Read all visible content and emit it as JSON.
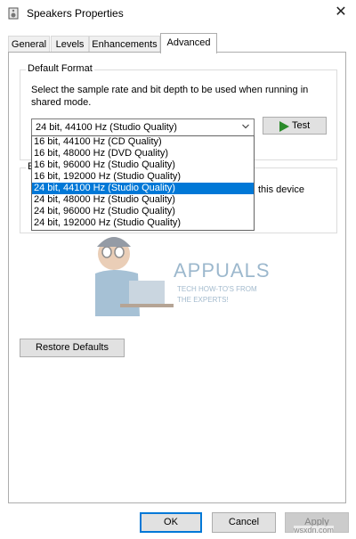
{
  "window": {
    "title": "Speakers Properties",
    "close_glyph": "✕",
    "icon": "speaker-icon"
  },
  "tabs": [
    {
      "label": "General"
    },
    {
      "label": "Levels"
    },
    {
      "label": "Enhancements"
    },
    {
      "label": "Advanced",
      "selected": true
    }
  ],
  "default_format": {
    "group_label": "Default Format",
    "description": "Select the sample rate and bit depth to be used when running in shared mode.",
    "selected_value": "24 bit, 44100 Hz (Studio Quality)",
    "options": [
      "16 bit, 44100 Hz (CD Quality)",
      "16 bit, 48000 Hz (DVD Quality)",
      "16 bit, 96000 Hz (Studio Quality)",
      "16 bit, 192000 Hz (Studio Quality)",
      "24 bit, 44100 Hz (Studio Quality)",
      "24 bit, 48000 Hz (Studio Quality)",
      "24 bit, 96000 Hz (Studio Quality)",
      "24 bit, 192000 Hz (Studio Quality)"
    ],
    "highlighted_index": 4,
    "test_label": "Test"
  },
  "exclusive_mode": {
    "group_label_partial": "E",
    "text_partial": "this device"
  },
  "watermark": {
    "title": "APPUALS",
    "sub1": "TECH HOW-TO'S FROM",
    "sub2": "THE EXPERTS!"
  },
  "restore_label": "Restore Defaults",
  "buttons": {
    "ok": "OK",
    "cancel": "Cancel",
    "apply": "Apply"
  },
  "site_mark": "wsxdn.com",
  "colors": {
    "highlight": "#0078d7",
    "test_arrow": "#2a8a2a",
    "watermark": "#4d7fa6"
  }
}
